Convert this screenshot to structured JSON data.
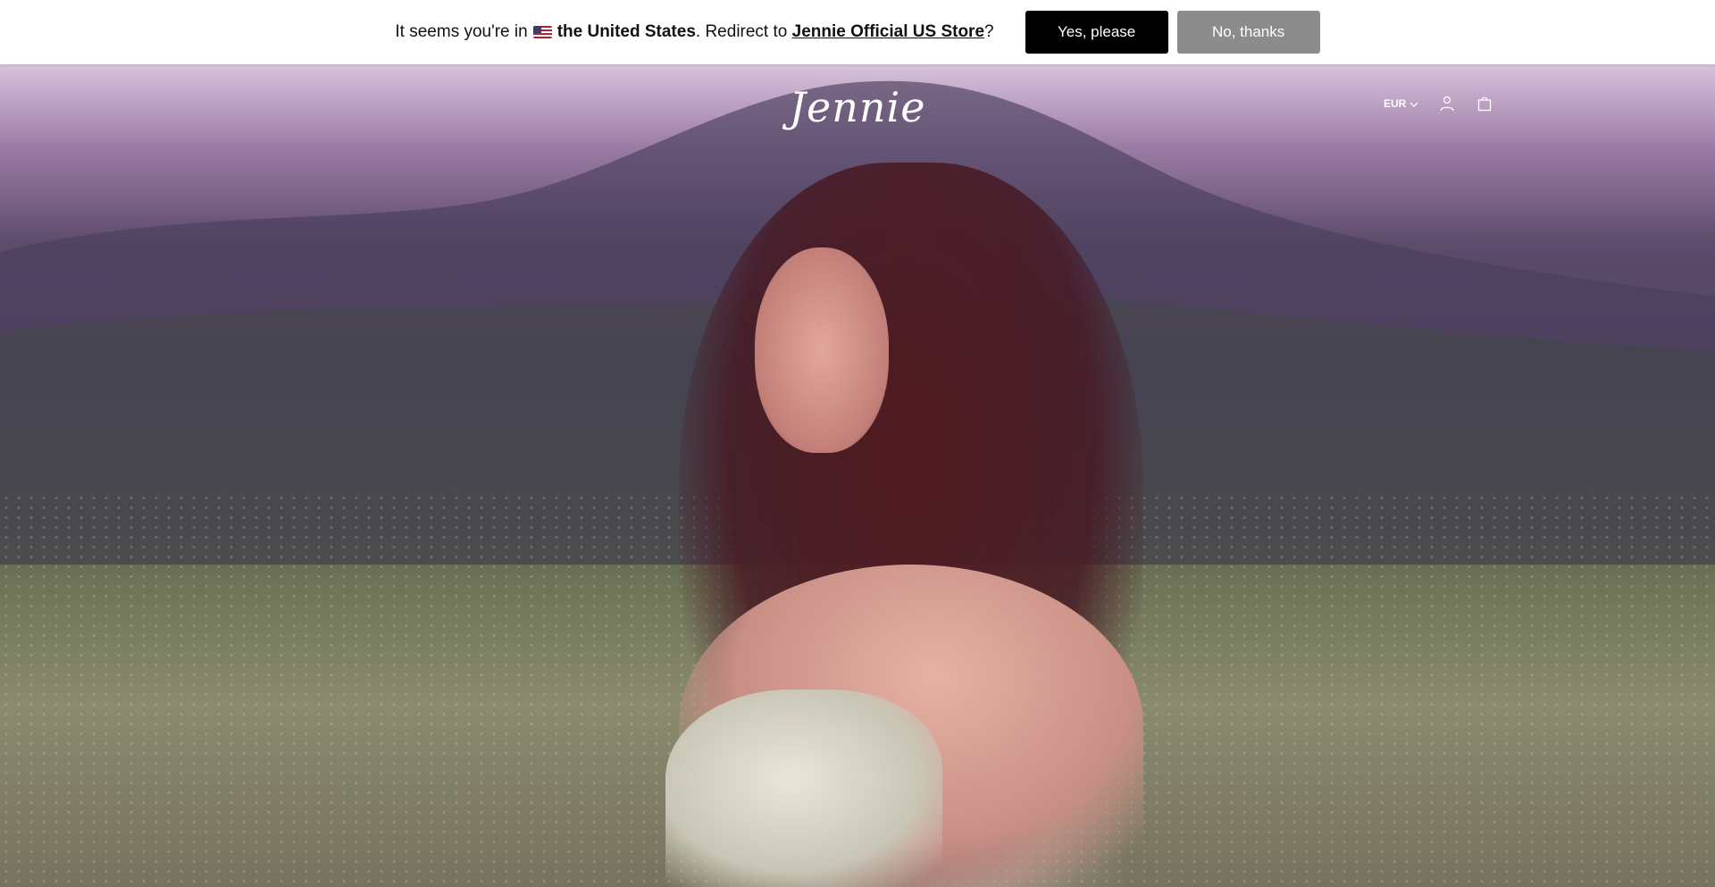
{
  "redirect_bar": {
    "prefix": "It seems you're in",
    "country": "the United States",
    "middle": ". Redirect to",
    "store_link": "Jennie Official US Store",
    "suffix": "?",
    "yes_button": "Yes, please",
    "no_button": "No, thanks",
    "flag_icon": "us-flag-icon"
  },
  "header": {
    "logo": "Jennie",
    "currency": "EUR",
    "icons": [
      "chevron-down-icon",
      "account-icon",
      "cart-icon"
    ]
  },
  "colors": {
    "primary_button": "#000000",
    "secondary_button": "#8c8c8c",
    "bar_background": "#ffffff"
  }
}
